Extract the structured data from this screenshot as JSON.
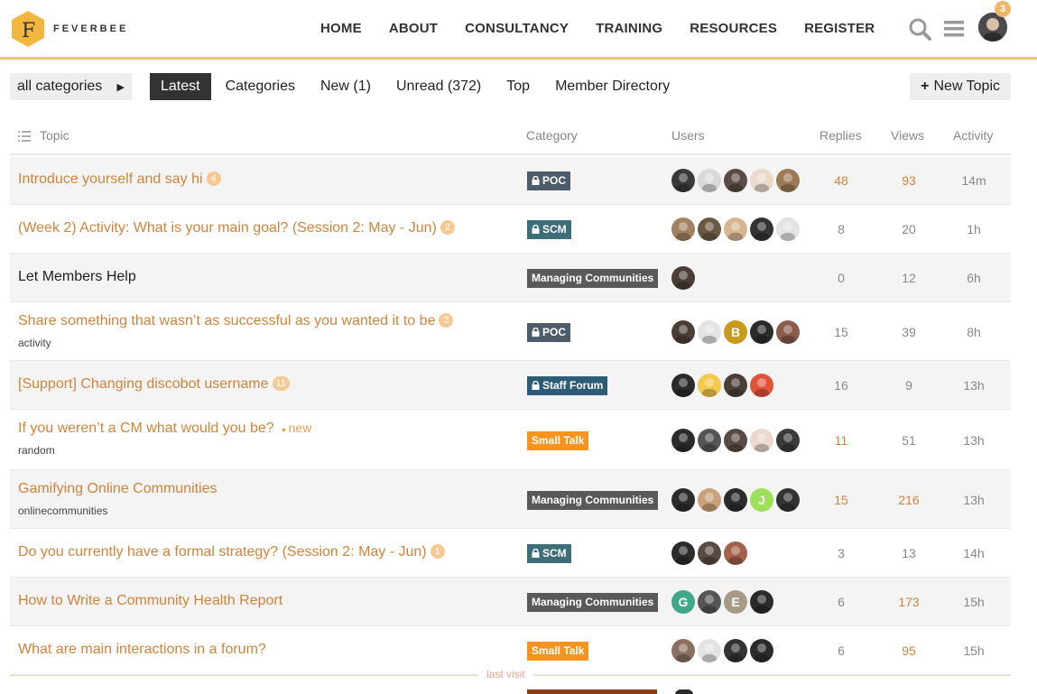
{
  "brand": {
    "logo_letter": "F",
    "name": "FEVERBEE"
  },
  "nav": [
    "HOME",
    "ABOUT",
    "CONSULTANCY",
    "TRAINING",
    "RESOURCES",
    "REGISTER"
  ],
  "header": {
    "notification_count": "3"
  },
  "filters": {
    "category_dropdown": "all categories",
    "tabs": [
      "Latest",
      "Categories",
      "New (1)",
      "Unread (372)",
      "Top",
      "Member Directory"
    ],
    "active_tab": "Latest",
    "new_topic_label": "New Topic"
  },
  "columns": {
    "topic": "Topic",
    "category": "Category",
    "users": "Users",
    "replies": "Replies",
    "views": "Views",
    "activity": "Activity"
  },
  "colors": {
    "accent": "#d0843a",
    "poc": "#4d5b6b",
    "scm": "#3c6d78",
    "managing": "#58595b",
    "staff": "#2c5c76",
    "smalltalk": "#f7941d"
  },
  "topics": [
    {
      "title": "Introduce yourself and say hi",
      "unread": "4",
      "new": "",
      "subtitle": "",
      "category": "POC",
      "locked": true,
      "cat_color": "#4d5b6b",
      "users": [
        {
          "l": "",
          "c": "#3a3a3a"
        },
        {
          "l": "",
          "c": "#d9d9d9"
        },
        {
          "l": "",
          "c": "#5a4a44"
        },
        {
          "l": "",
          "c": "#ead9cc"
        },
        {
          "l": "",
          "c": "#9c7a55"
        }
      ],
      "replies": "48",
      "views": "93",
      "activity": "14m",
      "hot_replies": true,
      "hot_views": true
    },
    {
      "title": "(Week 2) Activity: What is your main goal? (Session 2: May - Jun)",
      "unread": "2",
      "new": "",
      "subtitle": "",
      "category": "SCM",
      "locked": true,
      "cat_color": "#3c6d78",
      "users": [
        {
          "l": "",
          "c": "#a28160"
        },
        {
          "l": "",
          "c": "#6b5840"
        },
        {
          "l": "",
          "c": "#d7b590"
        },
        {
          "l": "",
          "c": "#333333"
        },
        {
          "l": "",
          "c": "#e3e3e3"
        }
      ],
      "replies": "8",
      "views": "20",
      "activity": "1h",
      "hot_replies": false,
      "hot_views": false
    },
    {
      "title": "Let Members Help",
      "unread": "",
      "new": "",
      "subtitle": "",
      "category": "Managing Communities",
      "locked": false,
      "cat_color": "#58595b",
      "users": [
        {
          "l": "",
          "c": "#4b3e38"
        }
      ],
      "replies": "0",
      "views": "12",
      "activity": "6h",
      "hot_replies": false,
      "hot_views": false,
      "plain": true
    },
    {
      "title": "Share something that wasn’t as successful as you wanted it to be",
      "unread": "3",
      "new": "",
      "subtitle": "activity",
      "category": "POC",
      "locked": true,
      "cat_color": "#4d5b6b",
      "users": [
        {
          "l": "",
          "c": "#4b3e38"
        },
        {
          "l": "",
          "c": "#e3e3e3"
        },
        {
          "l": "B",
          "c": "#c99a1c"
        },
        {
          "l": "",
          "c": "#2b2b2b"
        },
        {
          "l": "",
          "c": "#8a5a4a"
        }
      ],
      "replies": "15",
      "views": "39",
      "activity": "8h",
      "hot_replies": false,
      "hot_views": false
    },
    {
      "title": "[Support] Changing discobot username",
      "unread": "11",
      "new": "",
      "subtitle": "",
      "category": "Staff Forum",
      "locked": true,
      "cat_color": "#2c5c76",
      "users": [
        {
          "l": "",
          "c": "#2b2b2b"
        },
        {
          "l": "",
          "c": "#f2c94c"
        },
        {
          "l": "",
          "c": "#4b3e38"
        },
        {
          "l": "",
          "c": "#e2533b"
        }
      ],
      "replies": "16",
      "views": "9",
      "activity": "13h",
      "hot_replies": false,
      "hot_views": false
    },
    {
      "title": "If you weren’t a CM what would you be?",
      "unread": "",
      "new": "new",
      "subtitle": "random",
      "category": "Small Talk",
      "locked": false,
      "cat_color": "#f7941d",
      "users": [
        {
          "l": "",
          "c": "#2b2b2b"
        },
        {
          "l": "",
          "c": "#555555"
        },
        {
          "l": "",
          "c": "#5a4a44"
        },
        {
          "l": "",
          "c": "#ead9cc"
        },
        {
          "l": "",
          "c": "#3a3a3a"
        }
      ],
      "replies": "11",
      "views": "51",
      "activity": "13h",
      "hot_replies": true,
      "hot_views": false
    },
    {
      "title": "Gamifying Online Communities",
      "unread": "",
      "new": "",
      "subtitle": "onlinecommunities",
      "category": "Managing Communities",
      "locked": false,
      "cat_color": "#58595b",
      "users": [
        {
          "l": "",
          "c": "#2b2b2b"
        },
        {
          "l": "",
          "c": "#c9a27a"
        },
        {
          "l": "",
          "c": "#2b2b2b"
        },
        {
          "l": "J",
          "c": "#9de05a"
        },
        {
          "l": "",
          "c": "#333333"
        }
      ],
      "replies": "15",
      "views": "216",
      "activity": "13h",
      "hot_replies": true,
      "hot_views": true
    },
    {
      "title": "Do you currently have a formal strategy? (Session 2: May - Jun)",
      "unread": "1",
      "new": "",
      "subtitle": "",
      "category": "SCM",
      "locked": true,
      "cat_color": "#3c6d78",
      "users": [
        {
          "l": "",
          "c": "#2b2b2b"
        },
        {
          "l": "",
          "c": "#5a4a44"
        },
        {
          "l": "",
          "c": "#a1614a"
        }
      ],
      "replies": "3",
      "views": "13",
      "activity": "14h",
      "hot_replies": false,
      "hot_views": false
    },
    {
      "title": "How to Write a Community Health Report",
      "unread": "",
      "new": "",
      "subtitle": "",
      "category": "Managing Communities",
      "locked": false,
      "cat_color": "#58595b",
      "users": [
        {
          "l": "G",
          "c": "#3fa889"
        },
        {
          "l": "",
          "c": "#555555"
        },
        {
          "l": "E",
          "c": "#a79a86"
        },
        {
          "l": "",
          "c": "#2b2b2b"
        }
      ],
      "replies": "6",
      "views": "173",
      "activity": "15h",
      "hot_replies": false,
      "hot_views": true
    },
    {
      "title": "What are main interactions in a forum?",
      "unread": "",
      "new": "",
      "subtitle": "",
      "category": "Small Talk",
      "locked": false,
      "cat_color": "#f7941d",
      "users": [
        {
          "l": "",
          "c": "#8a7060"
        },
        {
          "l": "",
          "c": "#e3e3e3"
        },
        {
          "l": "",
          "c": "#333333"
        },
        {
          "l": "",
          "c": "#2b2b2b"
        }
      ],
      "replies": "6",
      "views": "95",
      "activity": "15h",
      "hot_replies": false,
      "hot_views": true
    }
  ],
  "last_visit_label": "last visit"
}
